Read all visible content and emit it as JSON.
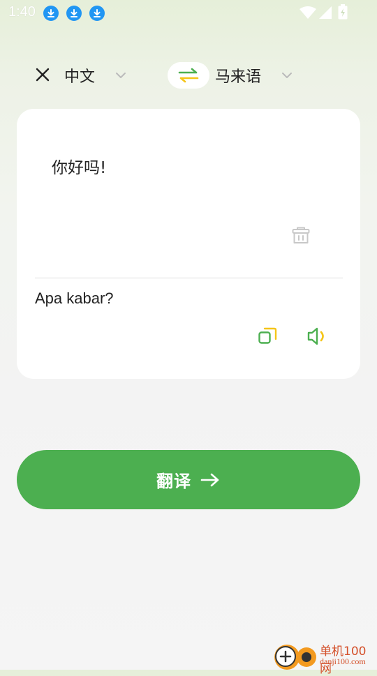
{
  "status_bar": {
    "time": "1:40",
    "download_notifications": [
      "download-icon",
      "download-icon",
      "download-icon"
    ],
    "system_icons": [
      "wifi-icon",
      "signal-icon",
      "battery-charging-icon"
    ]
  },
  "language_bar": {
    "source_language": "中文",
    "target_language": "马来语",
    "swap_icon": "swap-arrows-icon",
    "swap_colors": {
      "top_arrow": "#4caf50",
      "bottom_arrow": "#f5c518"
    }
  },
  "translation_card": {
    "input_text": "你好吗!",
    "output_text": "Apa kabar?",
    "delete_icon": "trash-icon",
    "copy_icon": "copy-icon",
    "speak_icon": "speaker-icon"
  },
  "translate_button": {
    "label": "翻译",
    "icon": "arrow-right-icon"
  },
  "watermark": {
    "title": "单机100网",
    "url": "danji100.com"
  },
  "colors": {
    "accent_green": "#4caf50",
    "accent_yellow": "#f5c518",
    "notification_blue": "#2196f3",
    "watermark_orange": "#d4502a"
  }
}
